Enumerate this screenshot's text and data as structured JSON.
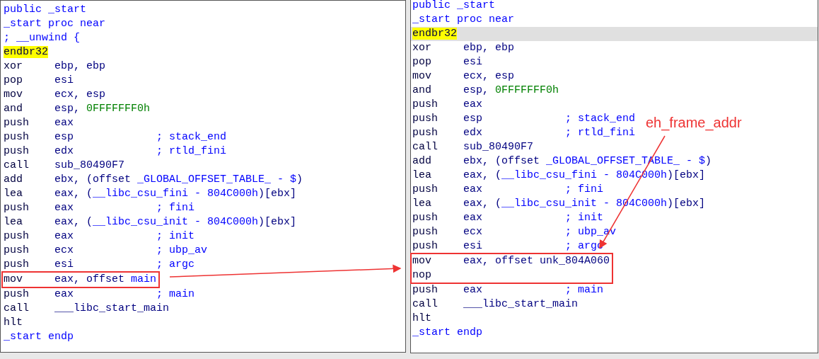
{
  "panels": [
    {
      "lines": [
        {
          "kind": "directive",
          "text": "public _start",
          "selected": false,
          "boxed": false
        },
        {
          "kind": "directive",
          "text": "_start proc near",
          "selected": false,
          "boxed": false
        },
        {
          "kind": "directive",
          "text": "; __unwind {",
          "selected": false,
          "boxed": false
        },
        {
          "kind": "instr",
          "mnemonic": "endbr32",
          "highlighted": true,
          "selected": false,
          "boxed": false
        },
        {
          "kind": "instr",
          "mnemonic": "xor",
          "highlighted": false,
          "operands": [
            {
              "text": "ebp, ebp",
              "kind": "reg"
            }
          ],
          "selected": false,
          "boxed": false
        },
        {
          "kind": "instr",
          "mnemonic": "pop",
          "highlighted": false,
          "operands": [
            {
              "text": "esi",
              "kind": "reg"
            }
          ],
          "selected": false,
          "boxed": false
        },
        {
          "kind": "instr",
          "mnemonic": "mov",
          "highlighted": false,
          "operands": [
            {
              "text": "ecx, esp",
              "kind": "reg"
            }
          ],
          "selected": false,
          "boxed": false
        },
        {
          "kind": "instr",
          "mnemonic": "and",
          "highlighted": false,
          "operands": [
            {
              "text": "esp, ",
              "kind": "reg"
            },
            {
              "text": "0FFFFFFF0h",
              "kind": "number"
            }
          ],
          "selected": false,
          "boxed": false
        },
        {
          "kind": "instr",
          "mnemonic": "push",
          "highlighted": false,
          "operands": [
            {
              "text": "eax",
              "kind": "reg"
            }
          ],
          "selected": false,
          "boxed": false
        },
        {
          "kind": "instr",
          "mnemonic": "push",
          "highlighted": false,
          "operands": [
            {
              "text": "esp",
              "kind": "reg"
            }
          ],
          "comment": "; stack_end",
          "selected": false,
          "boxed": false
        },
        {
          "kind": "instr",
          "mnemonic": "push",
          "highlighted": false,
          "operands": [
            {
              "text": "edx",
              "kind": "reg"
            }
          ],
          "comment": "; rtld_fini",
          "selected": false,
          "boxed": false
        },
        {
          "kind": "instr",
          "mnemonic": "call",
          "highlighted": false,
          "operands": [
            {
              "text": "sub_80490F7",
              "kind": "reg"
            }
          ],
          "selected": false,
          "boxed": false
        },
        {
          "kind": "instr",
          "mnemonic": "add",
          "highlighted": false,
          "operands": [
            {
              "text": "ebx, (offset ",
              "kind": "reg"
            },
            {
              "text": "_GLOBAL_OFFSET_TABLE_ - $",
              "kind": "name"
            },
            {
              "text": ")",
              "kind": "reg"
            }
          ],
          "selected": false,
          "boxed": false
        },
        {
          "kind": "instr",
          "mnemonic": "lea",
          "highlighted": false,
          "operands": [
            {
              "text": "eax, (",
              "kind": "reg"
            },
            {
              "text": "__libc_csu_fini - 804C000h",
              "kind": "name"
            },
            {
              "text": ")[ebx]",
              "kind": "reg"
            }
          ],
          "selected": false,
          "boxed": false
        },
        {
          "kind": "instr",
          "mnemonic": "push",
          "highlighted": false,
          "operands": [
            {
              "text": "eax",
              "kind": "reg"
            }
          ],
          "comment": "; fini",
          "selected": false,
          "boxed": false
        },
        {
          "kind": "instr",
          "mnemonic": "lea",
          "highlighted": false,
          "operands": [
            {
              "text": "eax, (",
              "kind": "reg"
            },
            {
              "text": "__libc_csu_init - 804C000h",
              "kind": "name"
            },
            {
              "text": ")[ebx]",
              "kind": "reg"
            }
          ],
          "selected": false,
          "boxed": false
        },
        {
          "kind": "instr",
          "mnemonic": "push",
          "highlighted": false,
          "operands": [
            {
              "text": "eax",
              "kind": "reg"
            }
          ],
          "comment": "; init",
          "selected": false,
          "boxed": false
        },
        {
          "kind": "instr",
          "mnemonic": "push",
          "highlighted": false,
          "operands": [
            {
              "text": "ecx",
              "kind": "reg"
            }
          ],
          "comment": "; ubp_av",
          "selected": false,
          "boxed": false
        },
        {
          "kind": "instr",
          "mnemonic": "push",
          "highlighted": false,
          "operands": [
            {
              "text": "esi",
              "kind": "reg"
            }
          ],
          "comment": "; argc",
          "selected": false,
          "boxed": false
        },
        {
          "kind": "instr",
          "mnemonic": "mov",
          "highlighted": false,
          "operands": [
            {
              "text": "eax, offset ",
              "kind": "reg"
            },
            {
              "text": "main",
              "kind": "name"
            }
          ],
          "selected": false,
          "boxed": true
        },
        {
          "kind": "instr",
          "mnemonic": "push",
          "highlighted": false,
          "operands": [
            {
              "text": "eax",
              "kind": "reg"
            }
          ],
          "comment": "; main",
          "selected": false,
          "boxed": false
        },
        {
          "kind": "instr",
          "mnemonic": "call",
          "highlighted": false,
          "operands": [
            {
              "text": "___libc_start_main",
              "kind": "reg"
            }
          ],
          "selected": false,
          "boxed": false
        },
        {
          "kind": "instr",
          "mnemonic": "hlt",
          "highlighted": false,
          "selected": false,
          "boxed": false
        },
        {
          "kind": "directive",
          "text": "_start endp",
          "selected": false,
          "boxed": false
        }
      ]
    },
    {
      "lines": [
        {
          "kind": "directive",
          "text": "public _start",
          "selected": false,
          "boxed": false
        },
        {
          "kind": "directive",
          "text": "_start proc near",
          "selected": false,
          "boxed": false
        },
        {
          "kind": "instr",
          "mnemonic": "endbr32",
          "highlighted": true,
          "selected": true,
          "boxed": false
        },
        {
          "kind": "instr",
          "mnemonic": "xor",
          "highlighted": false,
          "operands": [
            {
              "text": "ebp, ebp",
              "kind": "reg"
            }
          ],
          "selected": false,
          "boxed": false
        },
        {
          "kind": "instr",
          "mnemonic": "pop",
          "highlighted": false,
          "operands": [
            {
              "text": "esi",
              "kind": "reg"
            }
          ],
          "selected": false,
          "boxed": false
        },
        {
          "kind": "instr",
          "mnemonic": "mov",
          "highlighted": false,
          "operands": [
            {
              "text": "ecx, esp",
              "kind": "reg"
            }
          ],
          "selected": false,
          "boxed": false
        },
        {
          "kind": "instr",
          "mnemonic": "and",
          "highlighted": false,
          "operands": [
            {
              "text": "esp, ",
              "kind": "reg"
            },
            {
              "text": "0FFFFFFF0h",
              "kind": "number"
            }
          ],
          "selected": false,
          "boxed": false
        },
        {
          "kind": "instr",
          "mnemonic": "push",
          "highlighted": false,
          "operands": [
            {
              "text": "eax",
              "kind": "reg"
            }
          ],
          "selected": false,
          "boxed": false
        },
        {
          "kind": "instr",
          "mnemonic": "push",
          "highlighted": false,
          "operands": [
            {
              "text": "esp",
              "kind": "reg"
            }
          ],
          "comment": "; stack_end",
          "selected": false,
          "boxed": false
        },
        {
          "kind": "instr",
          "mnemonic": "push",
          "highlighted": false,
          "operands": [
            {
              "text": "edx",
              "kind": "reg"
            }
          ],
          "comment": "; rtld_fini",
          "selected": false,
          "boxed": false
        },
        {
          "kind": "instr",
          "mnemonic": "call",
          "highlighted": false,
          "operands": [
            {
              "text": "sub_80490F7",
              "kind": "reg"
            }
          ],
          "selected": false,
          "boxed": false
        },
        {
          "kind": "instr",
          "mnemonic": "add",
          "highlighted": false,
          "operands": [
            {
              "text": "ebx, (offset ",
              "kind": "reg"
            },
            {
              "text": "_GLOBAL_OFFSET_TABLE_ - $",
              "kind": "name"
            },
            {
              "text": ")",
              "kind": "reg"
            }
          ],
          "selected": false,
          "boxed": false
        },
        {
          "kind": "instr",
          "mnemonic": "lea",
          "highlighted": false,
          "operands": [
            {
              "text": "eax, (",
              "kind": "reg"
            },
            {
              "text": "__libc_csu_fini - 804C000h",
              "kind": "name"
            },
            {
              "text": ")[ebx]",
              "kind": "reg"
            }
          ],
          "selected": false,
          "boxed": false
        },
        {
          "kind": "instr",
          "mnemonic": "push",
          "highlighted": false,
          "operands": [
            {
              "text": "eax",
              "kind": "reg"
            }
          ],
          "comment": "; fini",
          "selected": false,
          "boxed": false
        },
        {
          "kind": "instr",
          "mnemonic": "lea",
          "highlighted": false,
          "operands": [
            {
              "text": "eax, (",
              "kind": "reg"
            },
            {
              "text": "__libc_csu_init - 804C000h",
              "kind": "name"
            },
            {
              "text": ")[ebx]",
              "kind": "reg"
            }
          ],
          "selected": false,
          "boxed": false
        },
        {
          "kind": "instr",
          "mnemonic": "push",
          "highlighted": false,
          "operands": [
            {
              "text": "eax",
              "kind": "reg"
            }
          ],
          "comment": "; init",
          "selected": false,
          "boxed": false
        },
        {
          "kind": "instr",
          "mnemonic": "push",
          "highlighted": false,
          "operands": [
            {
              "text": "ecx",
              "kind": "reg"
            }
          ],
          "comment": "; ubp_av",
          "selected": false,
          "boxed": false
        },
        {
          "kind": "instr",
          "mnemonic": "push",
          "highlighted": false,
          "operands": [
            {
              "text": "esi",
              "kind": "reg"
            }
          ],
          "comment": "; argc",
          "selected": false,
          "boxed": false
        },
        {
          "kind": "instr",
          "mnemonic": "mov",
          "highlighted": false,
          "operands": [
            {
              "text": "eax, offset unk_804A060",
              "kind": "reg"
            }
          ],
          "selected": false,
          "boxed": true
        },
        {
          "kind": "instr",
          "mnemonic": "nop",
          "highlighted": false,
          "selected": false,
          "boxed": true
        },
        {
          "kind": "instr",
          "mnemonic": "push",
          "highlighted": false,
          "operands": [
            {
              "text": "eax",
              "kind": "reg"
            }
          ],
          "comment": "; main",
          "selected": false,
          "boxed": false
        },
        {
          "kind": "instr",
          "mnemonic": "call",
          "highlighted": false,
          "operands": [
            {
              "text": "___libc_start_main",
              "kind": "reg"
            }
          ],
          "selected": false,
          "boxed": false
        },
        {
          "kind": "instr",
          "mnemonic": "hlt",
          "highlighted": false,
          "selected": false,
          "boxed": false
        },
        {
          "kind": "directive",
          "text": "_start endp",
          "selected": false,
          "boxed": false
        }
      ]
    }
  ],
  "annotation": {
    "text": "eh_frame_addr"
  }
}
